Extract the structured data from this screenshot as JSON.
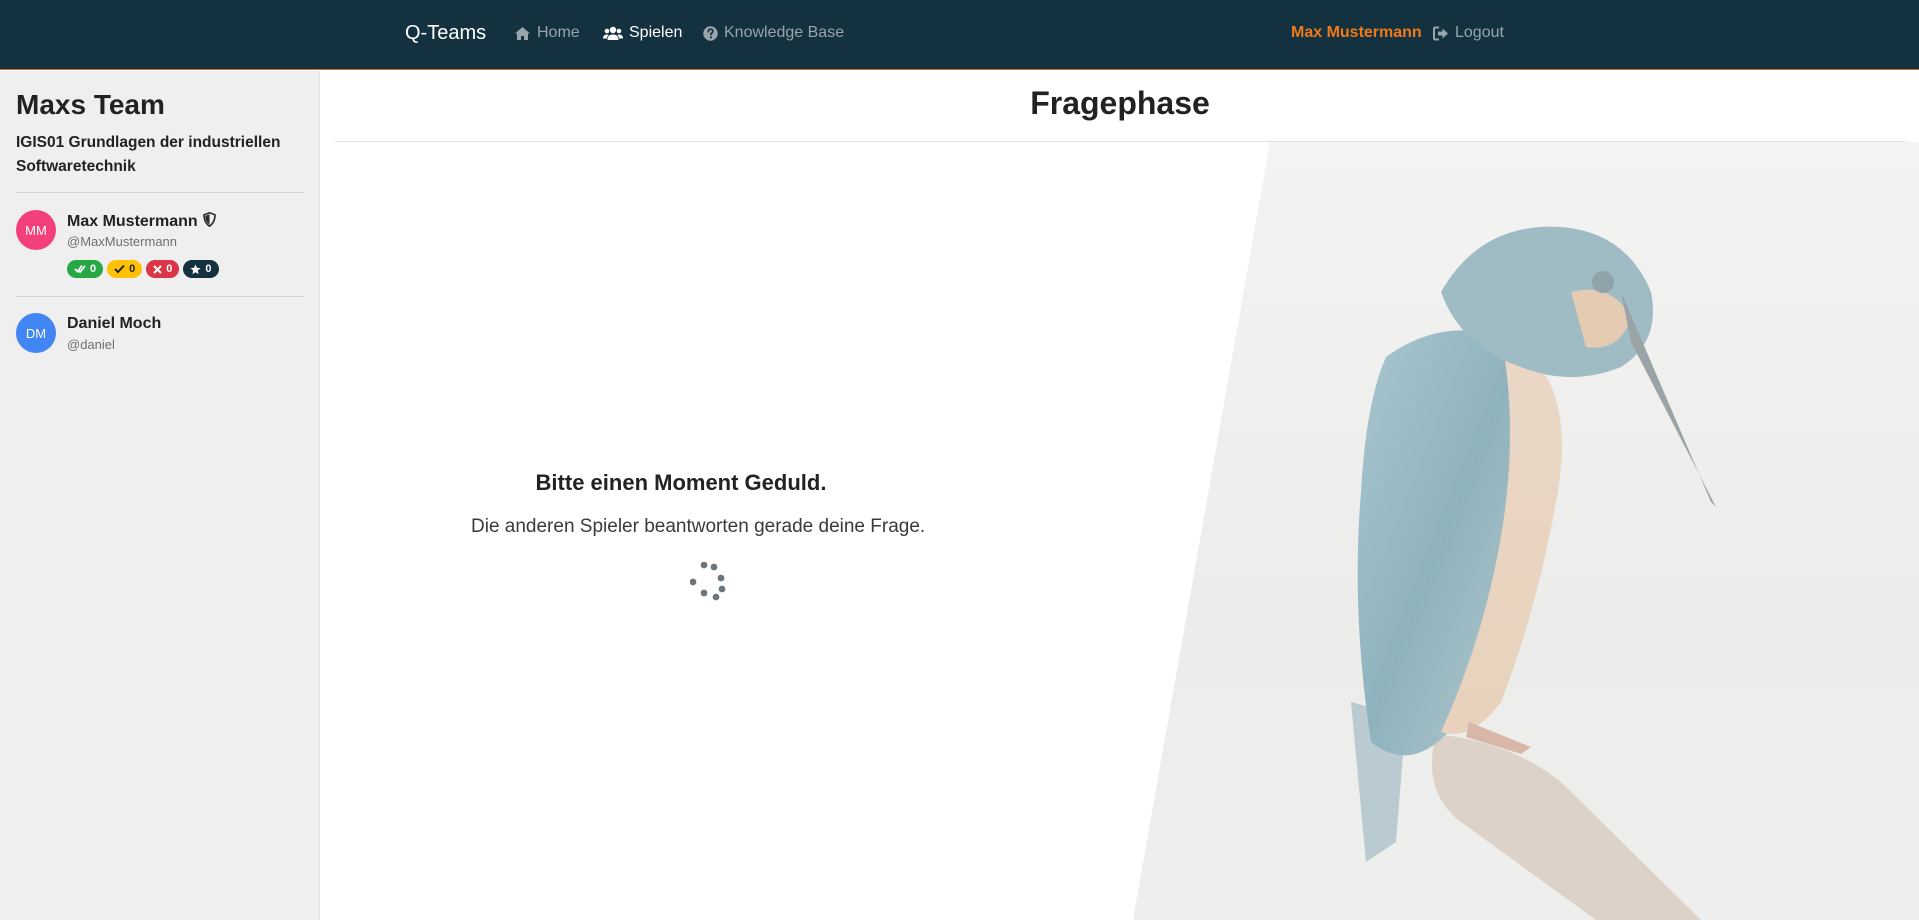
{
  "navbar": {
    "brand": "Q-Teams",
    "links": [
      {
        "label": "Home",
        "icon": "home-icon"
      },
      {
        "label": "Spielen",
        "icon": "users-icon",
        "active": true
      },
      {
        "label": "Knowledge Base",
        "icon": "question-circle-icon"
      }
    ],
    "user": "Max Mustermann",
    "logout": "Logout",
    "colors": {
      "background": "#13313f",
      "accent": "#f07a1a"
    }
  },
  "sidebar": {
    "team_name": "Maxs Team",
    "course": "IGIS01 Grundlagen der industriellen Softwaretechnik",
    "members": [
      {
        "initials": "MM",
        "name": "Max Mustermann",
        "handle": "@MaxMustermann",
        "role_icon": "shield-icon",
        "avatar_color": "#f4407a",
        "badges": [
          {
            "icon": "double-check-icon",
            "value": "0",
            "color": "#28a745"
          },
          {
            "icon": "check-icon",
            "value": "0",
            "color": "#ffc107"
          },
          {
            "icon": "x-icon",
            "value": "0",
            "color": "#dc3545"
          },
          {
            "icon": "star-icon",
            "value": "0",
            "color": "#13313f"
          }
        ]
      },
      {
        "initials": "DM",
        "name": "Daniel Moch",
        "handle": "@daniel",
        "avatar_color": "#4285f4"
      }
    ]
  },
  "main": {
    "title": "Fragephase",
    "wait_title": "Bitte einen Moment Geduld.",
    "wait_text": "Die anderen Spieler beantworten gerade deine Frage.",
    "spinner": "loading-spinner-icon",
    "background": "kingfisher-image"
  }
}
